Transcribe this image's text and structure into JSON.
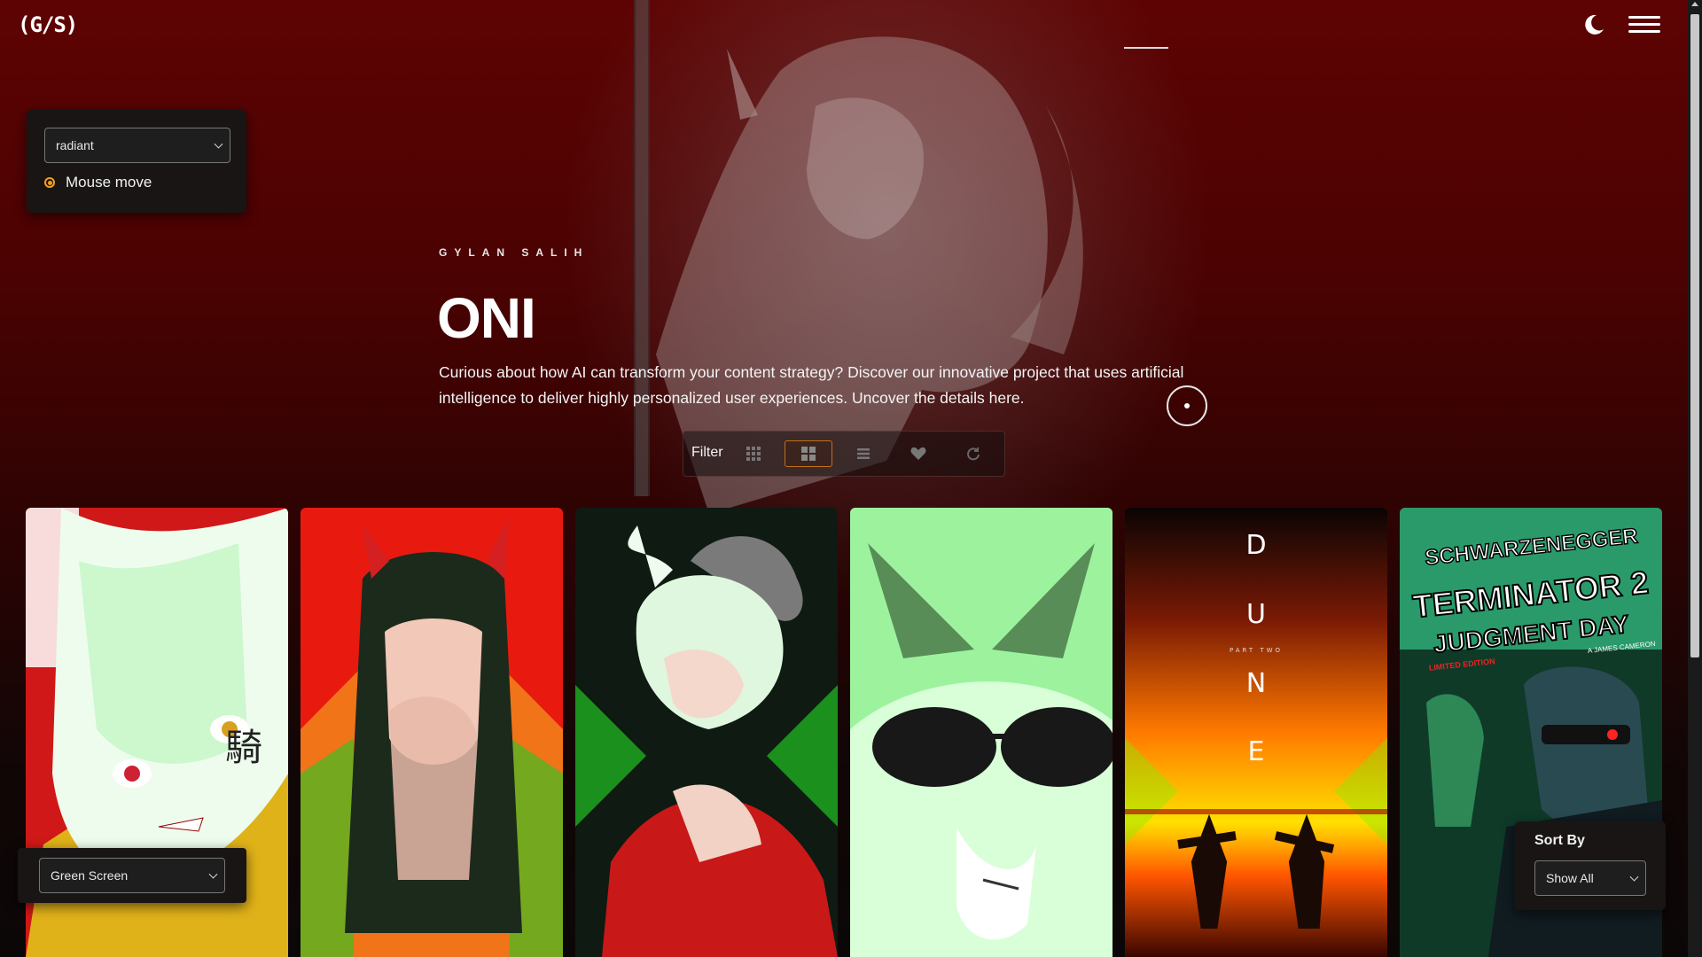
{
  "header": {
    "logo_text": "(G/S)",
    "theme_toggle_icon": "moon-icon",
    "menu_icon": "hamburger-menu-icon"
  },
  "effect_panel": {
    "effect_select_value": "radiant",
    "radio_label": "Mouse move"
  },
  "hero": {
    "kicker": "GYLAN SALIH",
    "title": "ONI",
    "description": "Curious about how AI can transform your content strategy? Discover our innovative project that uses artificial intelligence to deliver highly personalized user experiences. Uncover the details here."
  },
  "filter": {
    "label": "Filter",
    "buttons": [
      {
        "icon": "grid-small-icon",
        "active": false
      },
      {
        "icon": "grid-large-icon",
        "active": true
      },
      {
        "icon": "list-icon",
        "active": false
      },
      {
        "icon": "heart-icon",
        "active": false
      },
      {
        "icon": "refresh-icon",
        "active": false
      }
    ]
  },
  "cards": [
    {
      "name": "white-haired-anime-girl",
      "accent": "#9cff9c",
      "bg": "#d01818",
      "text": "騎"
    },
    {
      "name": "oni-girl-tattoos",
      "accent": "#33cc33",
      "bg": "#e81a10"
    },
    {
      "name": "horned-girl-red-dress",
      "accent": "#25e025",
      "bg": "#0e2a12"
    },
    {
      "name": "sunglasses-portrait",
      "accent": "#88ff88",
      "bg": "#d8ffd8"
    },
    {
      "name": "dune-part-two-poster",
      "accent": "#ffcc00",
      "bg": "#ff5500",
      "title_letters": [
        "D",
        "U",
        "N",
        "E"
      ],
      "subtitle": "PART TWO"
    },
    {
      "name": "terminator-2-poster",
      "accent": "#44dd44",
      "bg": "#1a5a3a",
      "top_text": "SCHWARZENEGGER",
      "title": "TERMINATOR 2",
      "subtitle": "JUDGMENT DAY",
      "edition": "LIMITED EDITION",
      "credit": "A JAMES CAMERON"
    }
  ],
  "bottom_panel": {
    "select_value": "Green Screen"
  },
  "sort_panel": {
    "label": "Sort By",
    "select_value": "Show All"
  },
  "colors": {
    "accent_orange": "#f0a020",
    "hero_red": "#5e0303"
  }
}
